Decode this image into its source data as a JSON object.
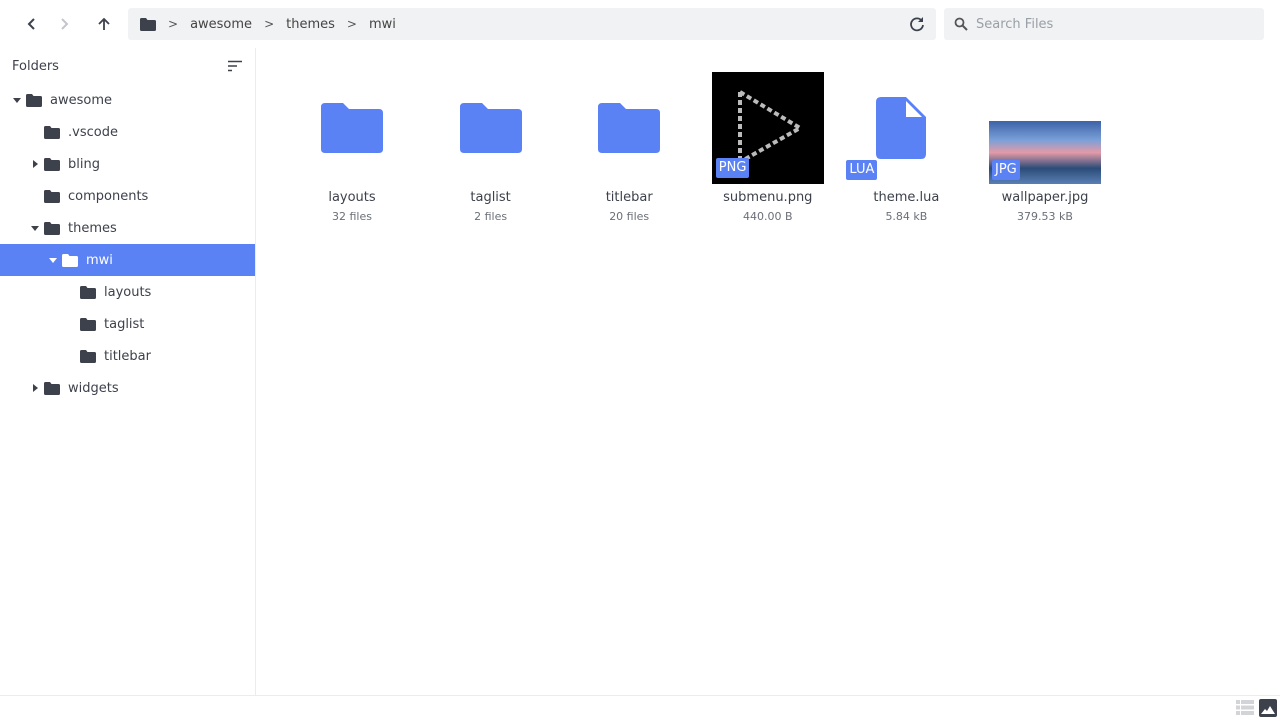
{
  "toolbar": {
    "back_icon": "chevron-left-icon",
    "forward_icon": "chevron-right-icon",
    "up_icon": "arrow-up-icon"
  },
  "breadcrumb": [
    "awesome",
    "themes",
    "mwi"
  ],
  "search": {
    "placeholder": "Search Files",
    "value": ""
  },
  "sidebar": {
    "title": "Folders",
    "tree": [
      {
        "label": "awesome",
        "level": 0,
        "caret": "down",
        "selected": false
      },
      {
        "label": ".vscode",
        "level": 1,
        "caret": "none",
        "selected": false
      },
      {
        "label": "bling",
        "level": 1,
        "caret": "right",
        "selected": false
      },
      {
        "label": "components",
        "level": 1,
        "caret": "none",
        "selected": false
      },
      {
        "label": "themes",
        "level": 1,
        "caret": "down",
        "selected": false
      },
      {
        "label": "mwi",
        "level": 2,
        "caret": "down",
        "selected": true
      },
      {
        "label": "layouts",
        "level": 3,
        "caret": "none",
        "selected": false
      },
      {
        "label": "taglist",
        "level": 3,
        "caret": "none",
        "selected": false
      },
      {
        "label": "titlebar",
        "level": 3,
        "caret": "none",
        "selected": false
      },
      {
        "label": "widgets",
        "level": 1,
        "caret": "right",
        "selected": false
      }
    ]
  },
  "files": [
    {
      "name": "layouts",
      "info": "32 files",
      "kind": "folder"
    },
    {
      "name": "taglist",
      "info": "2 files",
      "kind": "folder"
    },
    {
      "name": "titlebar",
      "info": "20 files",
      "kind": "folder"
    },
    {
      "name": "submenu.png",
      "info": "440.00 B",
      "kind": "png",
      "badge": "PNG"
    },
    {
      "name": "theme.lua",
      "info": "5.84 kB",
      "kind": "file",
      "badge": "LUA"
    },
    {
      "name": "wallpaper.jpg",
      "info": "379.53 kB",
      "kind": "jpg",
      "badge": "JPG"
    }
  ],
  "status": {
    "view_modes": [
      "list-view-icon",
      "grid-view-icon"
    ],
    "active": "grid-view-icon"
  },
  "colors": {
    "accent": "#5a82f5",
    "folder_dark": "#3d414b",
    "bar_bg": "#f1f2f4"
  }
}
